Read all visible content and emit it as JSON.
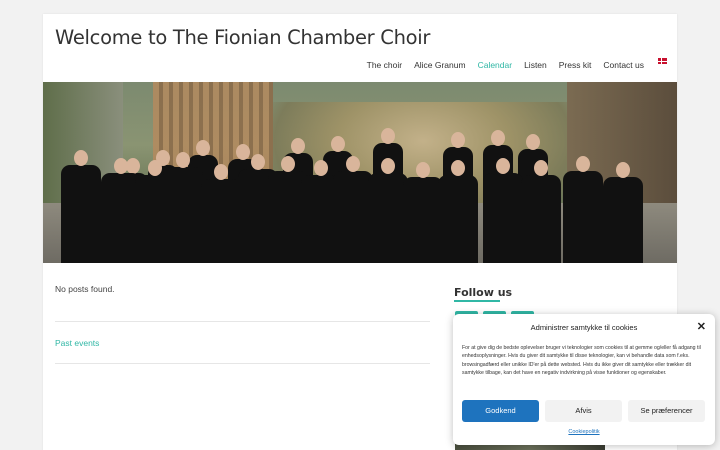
{
  "site": {
    "title": "Welcome to The Fionian Chamber Choir"
  },
  "nav": {
    "items": [
      {
        "label": "The choir"
      },
      {
        "label": "Alice Granum"
      },
      {
        "label": "Calendar",
        "active": true
      },
      {
        "label": "Listen"
      },
      {
        "label": "Press kit"
      },
      {
        "label": "Contact us"
      }
    ],
    "language_flag": "danish-flag-icon",
    "accent_color": "#30b7a5"
  },
  "main": {
    "empty_message": "No posts found.",
    "past_events_link": "Past events"
  },
  "sidebar": {
    "follow_heading": "Follow us",
    "social_icons": [
      "social-icon-1",
      "social-icon-2",
      "social-icon-3"
    ]
  },
  "cookie_banner": {
    "title": "Administrer samtykke til cookies",
    "body": "For at give dig de bedste oplevelser bruger vi teknologier som cookies til at gemme og/eller få adgang til enhedsoplysninger. Hvis du giver dit samtykke til disse teknologier, kan vi behandle data som f.eks. browsingadfærd eller unikke ID'er på dette websted. Hvis du ikke giver dit samtykke eller trækker dit samtykke tilbage, kan det have en negativ indvirkning på visse funktioner og egenskaber.",
    "accept_label": "Godkend",
    "deny_label": "Afvis",
    "preferences_label": "Se præferencer",
    "policy_link": "Cookiepolitik",
    "accept_color": "#1e73be"
  }
}
